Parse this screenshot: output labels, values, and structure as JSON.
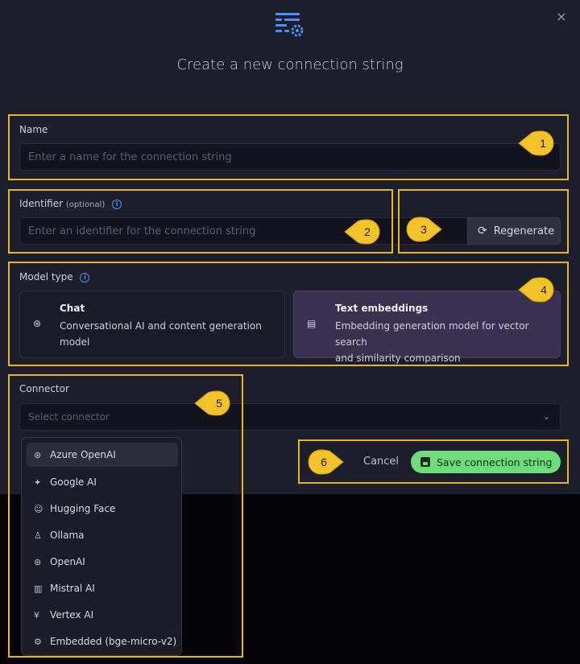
{
  "dialog": {
    "title": "Create a new connection string",
    "close_label": "×",
    "accent_color": "#4b8ff7"
  },
  "name_field": {
    "label": "Name",
    "placeholder": "Enter a name for the connection string",
    "value": ""
  },
  "identifier_field": {
    "label": "Identifier",
    "optional_text": "(optional)",
    "info_glyph": "i",
    "placeholder": "Enter an identifier for the connection string",
    "value": "",
    "regenerate_label": "Regenerate"
  },
  "model_type": {
    "label": "Model type",
    "info_glyph": "i",
    "options": [
      {
        "title": "Chat",
        "desc_line1": "Conversational AI and content generation",
        "desc_line2": "model",
        "icon": "brain-icon",
        "selected": false
      },
      {
        "title": "Text embeddings",
        "desc_line1": "Embedding generation model for vector search",
        "desc_line2": "and similarity comparison",
        "icon": "document-icon",
        "selected": true
      }
    ]
  },
  "connector": {
    "label": "Connector",
    "placeholder": "Select connector",
    "options": [
      {
        "label": "Azure OpenAI",
        "icon": "openai-logo-icon",
        "highlighted": true
      },
      {
        "label": "Google AI",
        "icon": "sparkle-icon"
      },
      {
        "label": "Hugging Face",
        "icon": "hugging-face-icon"
      },
      {
        "label": "Ollama",
        "icon": "ollama-icon"
      },
      {
        "label": "OpenAI",
        "icon": "openai-logo-icon"
      },
      {
        "label": "Mistral AI",
        "icon": "mistral-icon"
      },
      {
        "label": "Vertex AI",
        "icon": "vertex-icon"
      },
      {
        "label": "Embedded (bge-micro-v2)",
        "icon": "chip-icon"
      }
    ]
  },
  "actions": {
    "cancel_label": "Cancel",
    "save_label": "Save connection string",
    "save_color": "#6fdc7b"
  },
  "callouts": {
    "color": "#e8b71d",
    "numbers": [
      "1",
      "2",
      "3",
      "4",
      "5",
      "6"
    ]
  }
}
